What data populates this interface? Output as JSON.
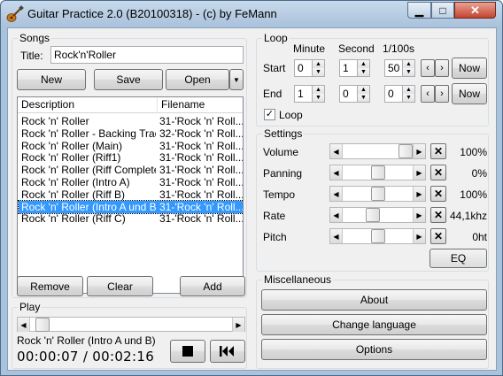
{
  "window": {
    "title": "Guitar Practice 2.0 (B20100318) - (c) by FeMann"
  },
  "songs": {
    "group_label": "Songs",
    "title_label": "Title:",
    "title_value": "Rock'n'Roller",
    "new_label": "New",
    "save_label": "Save",
    "open_label": "Open",
    "columns": [
      "Description",
      "Filename"
    ],
    "rows": [
      {
        "description": "Rock 'n' Roller",
        "filename": "31-'Rock 'n' Roll..."
      },
      {
        "description": "Rock 'n' Roller - Backing Track",
        "filename": "32-'Rock 'n' Roll..."
      },
      {
        "description": "Rock 'n' Roller (Main)",
        "filename": "31-'Rock 'n' Roll..."
      },
      {
        "description": "Rock 'n' Roller (Riff1)",
        "filename": "31-'Rock 'n' Roll..."
      },
      {
        "description": "Rock 'n' Roller (Riff Complete)",
        "filename": "31-'Rock 'n' Roll..."
      },
      {
        "description": "Rock 'n' Roller (Intro A)",
        "filename": "31-'Rock 'n' Roll..."
      },
      {
        "description": "Rock 'n' Roller (Riff B)",
        "filename": "31-'Rock 'n' Roll..."
      },
      {
        "description": "Rock 'n' Roller (Intro A und B)",
        "filename": "31-'Rock 'n' Roll...",
        "selected": true
      },
      {
        "description": "Rock 'n' Roller (Riff C)",
        "filename": "31-'Rock 'n' Roll..."
      }
    ],
    "remove_label": "Remove",
    "clear_label": "Clear",
    "add_label": "Add"
  },
  "play": {
    "group_label": "Play",
    "position_fraction": 0.03,
    "current_song": "Rock 'n' Roller (Intro A und B)",
    "elapsed": "00:00:07",
    "separator": "/",
    "total": "00:02:16"
  },
  "loop": {
    "group_label": "Loop",
    "minute_header": "Minute",
    "second_header": "Second",
    "hundredths_header": "1/100s",
    "start_label": "Start",
    "end_label": "End",
    "start": {
      "minute": "0",
      "second": "1",
      "hundredths": "50"
    },
    "end": {
      "minute": "1",
      "second": "0",
      "hundredths": "0"
    },
    "now_label": "Now",
    "loop_checkbox_label": "Loop",
    "loop_checked": true
  },
  "settings": {
    "group_label": "Settings",
    "sliders": [
      {
        "label": "Volume",
        "value": "100%",
        "position": 1.0
      },
      {
        "label": "Panning",
        "value": "0%",
        "position": 0.5
      },
      {
        "label": "Tempo",
        "value": "100%",
        "position": 0.5
      },
      {
        "label": "Rate",
        "value": "44,1khz",
        "position": 0.42
      },
      {
        "label": "Pitch",
        "value": "0ht",
        "position": 0.5
      }
    ],
    "eq_label": "EQ"
  },
  "misc": {
    "group_label": "Miscellaneous",
    "about_label": "About",
    "change_language_label": "Change language",
    "options_label": "Options"
  },
  "colors": {
    "selection": "#3399ff",
    "titlebar": "#a9c1db",
    "close_button": "#c4432f"
  }
}
